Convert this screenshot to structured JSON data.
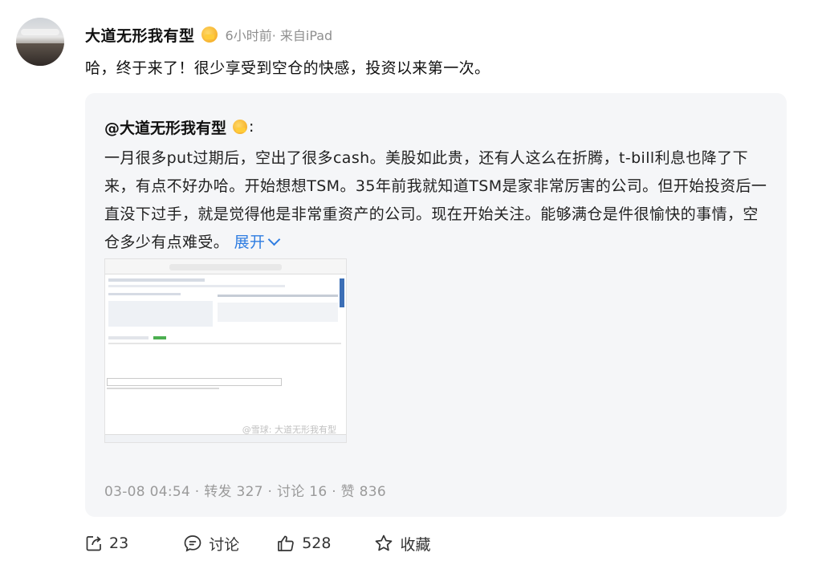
{
  "post": {
    "username": "大道无形我有型",
    "meta": "6小时前· 来自iPad",
    "text": "哈，终于来了！很少享受到空仓的快感，投资以来第一次。"
  },
  "quote": {
    "mention": "@大道无形我有型",
    "colon": ":",
    "body": "一月很多put过期后，空出了很多cash。美股如此贵，还有人这么在折腾，t-bill利息也降了下来，有点不好办哈。开始想想TSM。35年前我就知道TSM是家非常厉害的公司。但开始投资后一直没下过手，就是觉得他是非常重资产的公司。现在开始关注。能够满仓是件很愉快的事情，空仓多少有点难受。",
    "expand_label": "展开",
    "stats": "03-08 04:54 · 转发 327 · 讨论 16 · 赞 836",
    "thumbnail_watermark": "@雪球: 大道无形我有型"
  },
  "actions": {
    "repost": "23",
    "comment": "讨论",
    "like": "528",
    "favorite": "收藏"
  },
  "icons": [
    "repost-icon",
    "comment-icon",
    "like-icon",
    "star-icon",
    "chevron-down-icon",
    "verified-badge-icon"
  ]
}
